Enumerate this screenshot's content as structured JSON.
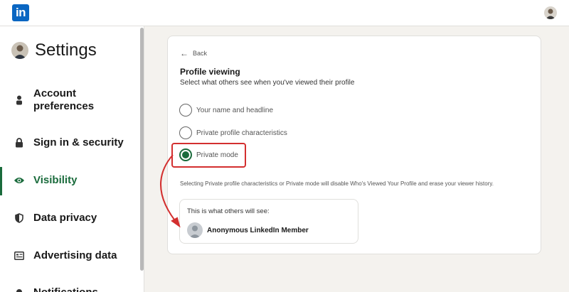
{
  "topbar": {
    "logo_text": "in",
    "avatar_icon": "profile-avatar"
  },
  "sidebar": {
    "title": "Settings",
    "items": [
      {
        "label": "Account preferences",
        "icon": "person-icon",
        "active": false
      },
      {
        "label": "Sign in & security",
        "icon": "lock-icon",
        "active": false
      },
      {
        "label": "Visibility",
        "icon": "eye-icon",
        "active": true
      },
      {
        "label": "Data privacy",
        "icon": "shield-icon",
        "active": false
      },
      {
        "label": "Advertising data",
        "icon": "newspaper-icon",
        "active": false
      },
      {
        "label": "Notifications",
        "icon": "bell-icon",
        "active": false
      }
    ]
  },
  "main": {
    "back_label": "Back",
    "section_title": "Profile viewing",
    "section_desc": "Select what others see when you've viewed their profile",
    "options": [
      {
        "label": "Your name and headline",
        "selected": false
      },
      {
        "label": "Private profile characteristics",
        "selected": false
      },
      {
        "label": "Private mode",
        "selected": true
      }
    ],
    "note": "Selecting Private profile characteristics or Private mode will disable Who's Viewed Your Profile and erase your viewer history.",
    "preview": {
      "label": "This is what others will see:",
      "name": "Anonymous LinkedIn Member"
    }
  },
  "colors": {
    "brand": "#0a66c2",
    "accent_green": "#1a6b3c",
    "annotation_red": "#d32f2f"
  }
}
